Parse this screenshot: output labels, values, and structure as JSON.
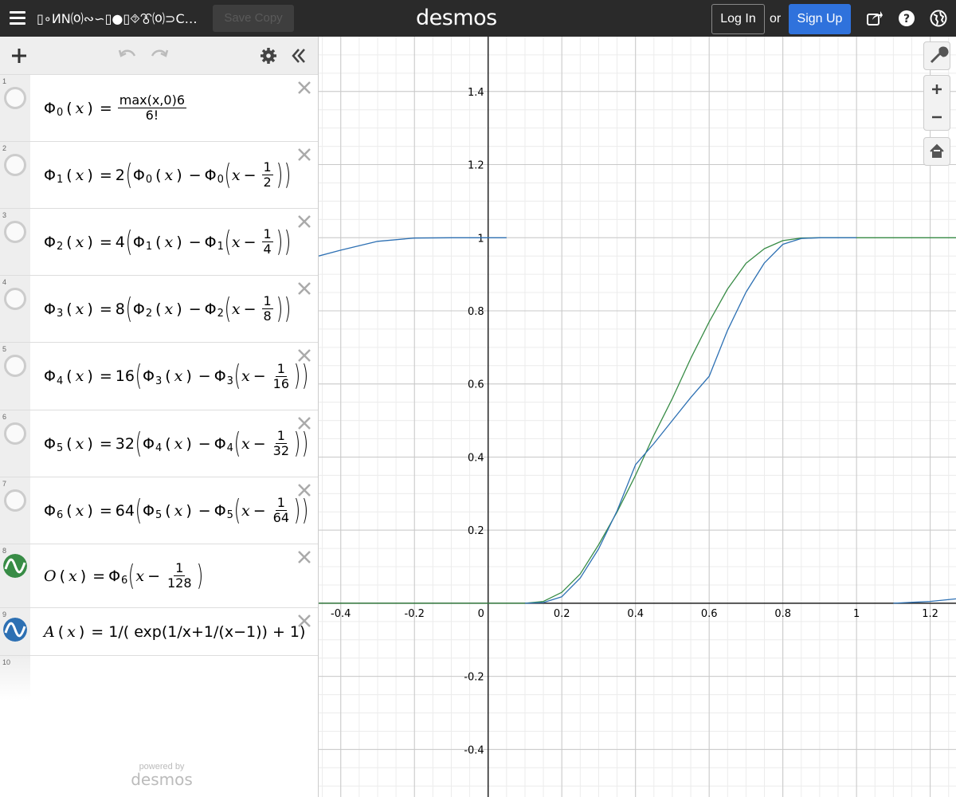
{
  "header": {
    "graph_title": "▯∘ИN⒪∾∽▯●▯⯑⯔⒪⊃C…",
    "save_label": "Save Copy",
    "logo": "desmos",
    "login_label": "Log In",
    "or_label": "or",
    "signup_label": "Sign Up",
    "icons": [
      "share-icon",
      "help-icon",
      "globe-icon"
    ]
  },
  "toolbar": {
    "icons": [
      "plus-icon",
      "undo-icon",
      "redo-icon",
      "gear-icon",
      "collapse-icon"
    ]
  },
  "expressions": [
    {
      "num": "1",
      "latex": "\\Phi_0(x) = max(x,0)^6 / 6!"
    },
    {
      "num": "2",
      "latex": "\\Phi_1(x) = 2(\\Phi_0(x) - \\Phi_0(x - 1/2))"
    },
    {
      "num": "3",
      "latex": "\\Phi_2(x) = 4(\\Phi_1(x) - \\Phi_1(x - 1/4))"
    },
    {
      "num": "4",
      "latex": "\\Phi_3(x) = 8(\\Phi_2(x) - \\Phi_2(x - 1/8))"
    },
    {
      "num": "5",
      "latex": "\\Phi_4(x) = 16(\\Phi_3(x) - \\Phi_3(x - 1/16))"
    },
    {
      "num": "6",
      "latex": "\\Phi_5(x) = 32(\\Phi_4(x) - \\Phi_4(x - 1/32))"
    },
    {
      "num": "7",
      "latex": "\\Phi_6(x) = 64(\\Phi_5(x) - \\Phi_5(x - 1/64))"
    },
    {
      "num": "8",
      "latex": "O(x) = \\Phi_6(x - 1/128)",
      "color": "#388c46"
    },
    {
      "num": "9",
      "latex": "A(x) = 1/(exp(1/x + 1/(x-1)) + 1)",
      "color": "#2d70b3"
    },
    {
      "num": "10",
      "latex": ""
    }
  ],
  "expr_text": {
    "e1": {
      "lhs": "Φ",
      "lhs_sub": "0",
      "var": "x",
      "frac_num": "max(x,0)6",
      "frac_den": "6!"
    },
    "e2": {
      "coef": "2",
      "lhs_sub": "1",
      "in_sub": "0",
      "frac_num": "1",
      "frac_den": "2"
    },
    "e3": {
      "coef": "4",
      "lhs_sub": "2",
      "in_sub": "1",
      "frac_num": "1",
      "frac_den": "4"
    },
    "e4": {
      "coef": "8",
      "lhs_sub": "3",
      "in_sub": "2",
      "frac_num": "1",
      "frac_den": "8"
    },
    "e5": {
      "coef": "16",
      "lhs_sub": "4",
      "in_sub": "3",
      "frac_num": "1",
      "frac_den": "16"
    },
    "e6": {
      "coef": "32",
      "lhs_sub": "5",
      "in_sub": "4",
      "frac_num": "1",
      "frac_den": "32"
    },
    "e7": {
      "coef": "64",
      "lhs_sub": "6",
      "in_sub": "5",
      "frac_num": "1",
      "frac_den": "64"
    },
    "e8": {
      "lhs": "O",
      "inner_sub": "6",
      "frac_num": "1",
      "frac_den": "128"
    },
    "e9": {
      "lhs": "A",
      "rhs": "= 1/( exp(1/x+1/(x−1)) + 1)"
    }
  },
  "footer": {
    "powered_by": "powered by",
    "logo": "desmos"
  },
  "graph_controls": {
    "icons": [
      "wrench-icon",
      "zoom-in-icon",
      "zoom-out-icon",
      "home-icon"
    ]
  },
  "chart_data": {
    "type": "line",
    "title": "",
    "xlabel": "",
    "ylabel": "",
    "xlim": [
      -0.46,
      1.27
    ],
    "ylim": [
      -0.53,
      1.55
    ],
    "x_ticks": [
      -0.4,
      -0.2,
      0,
      0.2,
      0.4,
      0.6,
      0.8,
      1,
      1.2
    ],
    "x_tick_labels": [
      "-0.4",
      "-0.2",
      "0",
      "0.2",
      "0.4",
      "0.6",
      "0.8",
      "1",
      "1.2"
    ],
    "y_ticks": [
      -0.4,
      -0.2,
      0.2,
      0.4,
      0.6,
      0.8,
      1,
      1.2,
      1.4
    ],
    "y_tick_labels": [
      "-0.4",
      "-0.2",
      "0.2",
      "0.4",
      "0.6",
      "0.8",
      "1",
      "1.2",
      "1.4"
    ],
    "grid": true,
    "series": [
      {
        "function": "O(x) = Φ₆(x − 1/128)",
        "color": "#388c46",
        "x": [
          -0.46,
          0,
          0.1,
          0.15,
          0.2,
          0.25,
          0.3,
          0.35,
          0.4,
          0.45,
          0.5,
          0.55,
          0.6,
          0.65,
          0.7,
          0.75,
          0.8,
          0.85,
          0.9,
          1,
          1.27
        ],
        "y": [
          0,
          0,
          0,
          0.005,
          0.03,
          0.08,
          0.16,
          0.25,
          0.35,
          0.46,
          0.56,
          0.67,
          0.77,
          0.86,
          0.93,
          0.97,
          0.992,
          0.999,
          1,
          1,
          1
        ]
      },
      {
        "function": "A(x) = 1/(exp(1/x + 1/(x−1)) + 1)",
        "color": "#2d70b3",
        "x": [
          -0.46,
          -0.4,
          -0.3,
          -0.2,
          -0.1,
          0,
          0.05,
          0.1,
          0.15,
          0.2,
          0.25,
          0.3,
          0.35,
          0.4,
          0.45,
          0.5,
          0.55,
          0.6,
          0.65,
          0.7,
          0.75,
          0.8,
          0.85,
          0.9,
          0.95,
          1,
          1.1,
          1.2,
          1.27
        ],
        "y": [
          0.95,
          0.966,
          0.99,
          0.999,
          1,
          1,
          1,
          0.0,
          0.002,
          0.018,
          0.069,
          0.149,
          0.253,
          0.379,
          0.437,
          0.5,
          0.563,
          0.621,
          0.747,
          0.851,
          0.931,
          0.982,
          0.998,
          1,
          1,
          1,
          0.0,
          0.005,
          0.012
        ]
      }
    ]
  }
}
